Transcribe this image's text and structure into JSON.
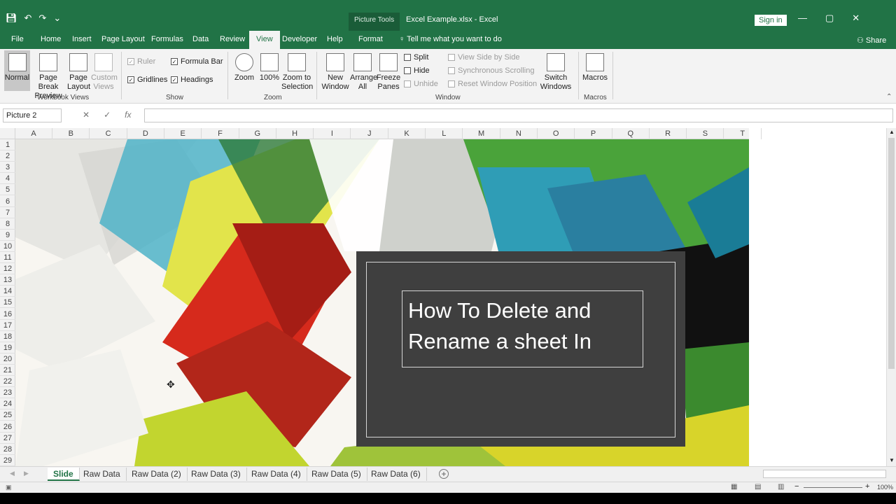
{
  "window": {
    "context_label": "Picture Tools",
    "title": "Excel Example.xlsx  -  Excel",
    "sign_in": "Sign in",
    "controls": [
      "—",
      "▢",
      "✕"
    ]
  },
  "ribbon_tabs": {
    "file": "File",
    "home": "Home",
    "insert": "Insert",
    "page_layout": "Page Layout",
    "formulas": "Formulas",
    "data": "Data",
    "review": "Review",
    "view": "View",
    "developer": "Developer",
    "help": "Help",
    "format": "Format",
    "tell_me": "Tell me what you want to do",
    "share": "Share"
  },
  "ribbon": {
    "workbook_views": {
      "normal": "Normal",
      "page_break_preview": "Page Break Preview",
      "page_layout": "Page Layout",
      "custom_views": "Custom Views",
      "label": "Workbook Views"
    },
    "show": {
      "ruler": "Ruler",
      "formula_bar": "Formula Bar",
      "gridlines": "Gridlines",
      "headings": "Headings",
      "label": "Show"
    },
    "zoom": {
      "zoom": "Zoom",
      "hundred": "100%",
      "zoom_to_selection": "Zoom to Selection",
      "label": "Zoom"
    },
    "window": {
      "new_window": "New Window",
      "arrange_all": "Arrange All",
      "freeze_panes": "Freeze Panes",
      "split": "Split",
      "hide": "Hide",
      "unhide": "Unhide",
      "view_side_by_side": "View Side by Side",
      "synchronous_scrolling": "Synchronous Scrolling",
      "reset_window_position": "Reset Window Position",
      "switch_windows": "Switch Windows",
      "label": "Window"
    },
    "macros": {
      "macros": "Macros",
      "label": "Macros"
    }
  },
  "formula_bar": {
    "name_box": "Picture 2",
    "fx": "fx",
    "formula": ""
  },
  "grid": {
    "columns": [
      "A",
      "B",
      "C",
      "D",
      "E",
      "F",
      "G",
      "H",
      "I",
      "J",
      "K",
      "L",
      "M",
      "N",
      "O",
      "P",
      "Q",
      "R",
      "S",
      "T"
    ],
    "rows": [
      "1",
      "2",
      "3",
      "4",
      "5",
      "6",
      "7",
      "8",
      "9",
      "10",
      "11",
      "12",
      "13",
      "14",
      "15",
      "16",
      "17",
      "18",
      "19",
      "20",
      "21",
      "22",
      "23",
      "24",
      "25",
      "26",
      "27",
      "28",
      "29"
    ]
  },
  "slide": {
    "title_line1": "How To Delete and",
    "title_line2": "Rename a sheet In"
  },
  "sheets": [
    "Slide",
    "Raw Data",
    "Raw Data (2)",
    "Raw Data (3)",
    "Raw Data (4)",
    "Raw Data (5)",
    "Raw Data (6)"
  ],
  "status": {
    "zoom": "100%"
  },
  "colors": {
    "excel_green": "#217346",
    "ribbon_bg": "#f3f3f3",
    "slide_dark": "#3f3f3f"
  }
}
